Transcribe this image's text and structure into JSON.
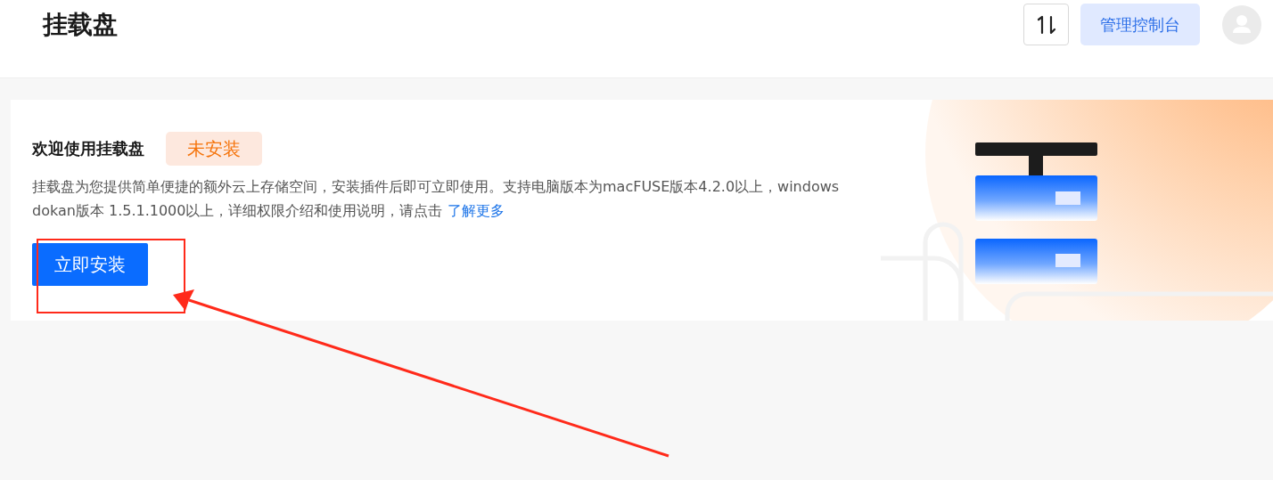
{
  "header": {
    "title": "挂载盘",
    "console_button": "管理控制台"
  },
  "card": {
    "title": "欢迎使用挂载盘",
    "status_badge": "未安装",
    "description": "挂载盘为您提供简单便捷的额外云上存储空间，安装插件后即可立即使用。支持电脑版本为macFUSE版本4.2.0以上，windows dokan版本 1.5.1.1000以上，详细权限介绍和使用说明，请点击 ",
    "learn_more_link": "了解更多",
    "install_button": "立即安装"
  }
}
